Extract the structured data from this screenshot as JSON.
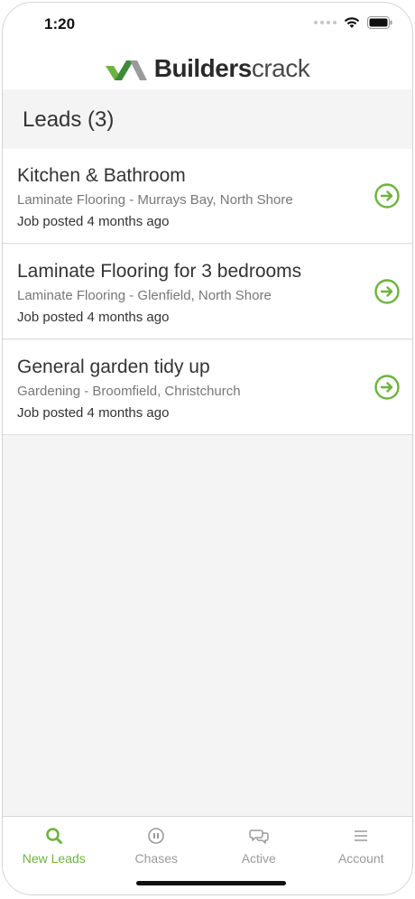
{
  "status": {
    "time": "1:20"
  },
  "header": {
    "brand_bold": "Builders",
    "brand_light": "crack"
  },
  "page": {
    "title": "Leads (3)"
  },
  "leads": [
    {
      "title": "Kitchen & Bathroom",
      "subtitle": "Laminate Flooring - Murrays Bay, North Shore",
      "posted": "Job posted 4 months ago"
    },
    {
      "title": "Laminate Flooring for 3 bedrooms",
      "subtitle": "Laminate Flooring - Glenfield, North Shore",
      "posted": "Job posted 4 months ago"
    },
    {
      "title": "General garden tidy up",
      "subtitle": "Gardening - Broomfield, Christchurch",
      "posted": "Job posted 4 months ago"
    }
  ],
  "tabs": [
    {
      "label": "New Leads",
      "icon": "search-icon",
      "active": true
    },
    {
      "label": "Chases",
      "icon": "pause-icon",
      "active": false
    },
    {
      "label": "Active",
      "icon": "chat-icon",
      "active": false
    },
    {
      "label": "Account",
      "icon": "menu-icon",
      "active": false
    }
  ],
  "colors": {
    "accent": "#6db33f",
    "logo_dark_green": "#3f8a3a",
    "logo_grey": "#9a9a9a"
  }
}
